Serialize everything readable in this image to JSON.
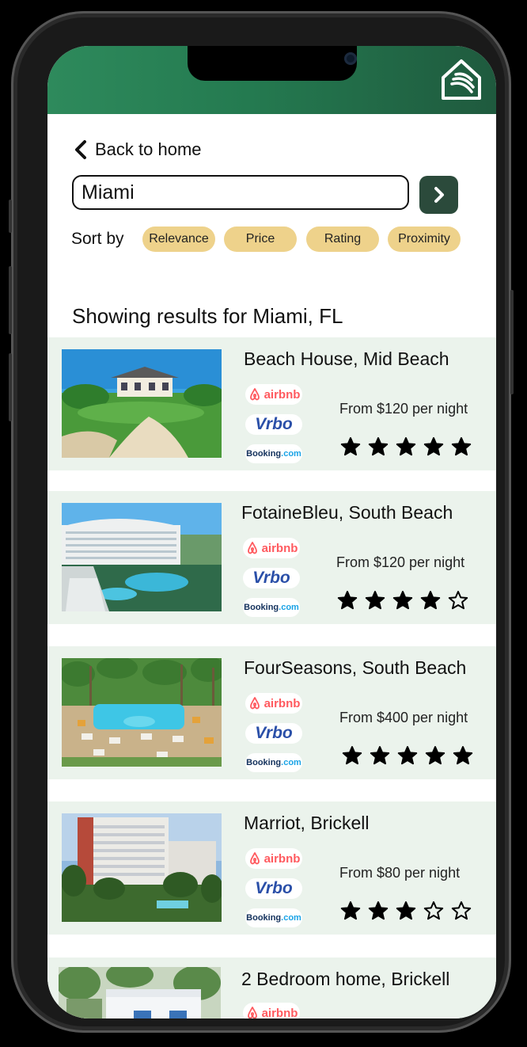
{
  "nav": {
    "back_label": "Back to home"
  },
  "search": {
    "value": "Miami"
  },
  "sort": {
    "label": "Sort by",
    "options": [
      "Relevance",
      "Price",
      "Rating",
      "Proximity"
    ]
  },
  "results": {
    "heading": "Showing results for Miami, FL",
    "providers": {
      "airbnb": "airbnb",
      "vrbo": "Vrbo",
      "booking_name": "Booking",
      "booking_suffix": ".com"
    },
    "listings": [
      {
        "title": "Beach House, Mid Beach",
        "price": "From $120 per night",
        "rating": 5
      },
      {
        "title": "FotaineBleu, South Beach",
        "price": "From $120 per night",
        "rating": 4
      },
      {
        "title": "FourSeasons, South Beach",
        "price": "From $400 per night",
        "rating": 5
      },
      {
        "title": "Marriot, Brickell",
        "price": "From $80 per night",
        "rating": 3
      },
      {
        "title": "2 Bedroom home, Brickell"
      }
    ]
  },
  "colors": {
    "header_gradient_start": "#2e8a5c",
    "header_gradient_end": "#1f5a3e",
    "chip": "#eed28b",
    "card_bg": "#ebf3ec",
    "go_button": "#2b4a3b",
    "airbnb": "#ff5a5f",
    "vrbo": "#2a4fa8"
  },
  "icons": {
    "logo": "house-logo-icon",
    "back": "chevron-left-icon",
    "go": "chevron-right-icon",
    "star_filled": "star-filled-icon",
    "star_empty": "star-outline-icon"
  }
}
